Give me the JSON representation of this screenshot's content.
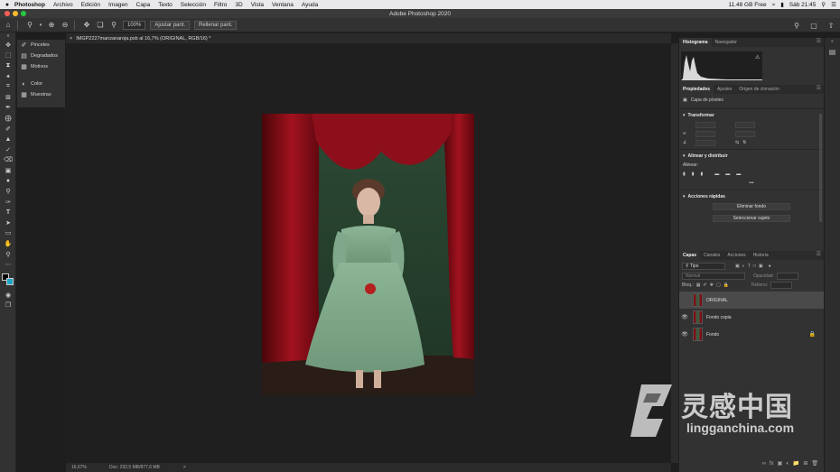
{
  "menubar": {
    "apple": "",
    "items": [
      "Photoshop",
      "Archivo",
      "Edición",
      "Imagen",
      "Capa",
      "Texto",
      "Selección",
      "Filtro",
      "3D",
      "Vista",
      "Ventana",
      "Ayuda"
    ],
    "storage": "11.48 GB Free",
    "clock": "Sáb 21:45"
  },
  "window": {
    "title": "Adobe Photoshop 2020"
  },
  "options": {
    "zoom_value": "100%",
    "fit_label": "Ajustar pant.",
    "fill_label": "Rellenar pant."
  },
  "left_panels": [
    "Pinceles",
    "Degradados",
    "Motivos",
    "Color",
    "Muestras"
  ],
  "document": {
    "tab_title": "IMGP2227manzanaroja.psb al 16,7% (ORIGINAL, RGB/16) *",
    "status_zoom": "16,67%",
    "status_doc": "Doc: 292,5 MB/877,6 MB",
    "status_arrow": ">"
  },
  "histogram": {
    "tabs": [
      "Histograma",
      "Navegador"
    ]
  },
  "properties": {
    "tabs": [
      "Propiedades",
      "Ajustes",
      "Origen de clonación"
    ],
    "layer_type": "Capa de píxeles",
    "transform_title": "Transformar",
    "align_title": "Alinear y distribuir",
    "align_label": "Alinear:",
    "more": "•••",
    "quick_actions_title": "Acciones rápidas",
    "remove_bg": "Eliminar fondo",
    "select_subject": "Seleccionar sujeto"
  },
  "layers": {
    "tabs": [
      "Capas",
      "Canales",
      "Acciones",
      "Historia"
    ],
    "filter_kind": "Tipo",
    "blend_mode": "Normal",
    "opacity_label": "Opacidad:",
    "lock_label": "Bloq.:",
    "fill_label": "Relleno:",
    "items": [
      {
        "name": "ORIGINAL",
        "visible": false,
        "active": true,
        "locked": false
      },
      {
        "name": "Fondo copia",
        "visible": true,
        "active": false,
        "locked": false
      },
      {
        "name": "Fondo",
        "visible": true,
        "active": false,
        "locked": true
      }
    ]
  },
  "watermark": {
    "cn": "灵感中国",
    "en": "lingganchina.com"
  },
  "colors": {
    "foreground": "#000000",
    "background": "#1ea7c7",
    "panel": "#323232",
    "selected_layer": "#4a4a4a"
  }
}
